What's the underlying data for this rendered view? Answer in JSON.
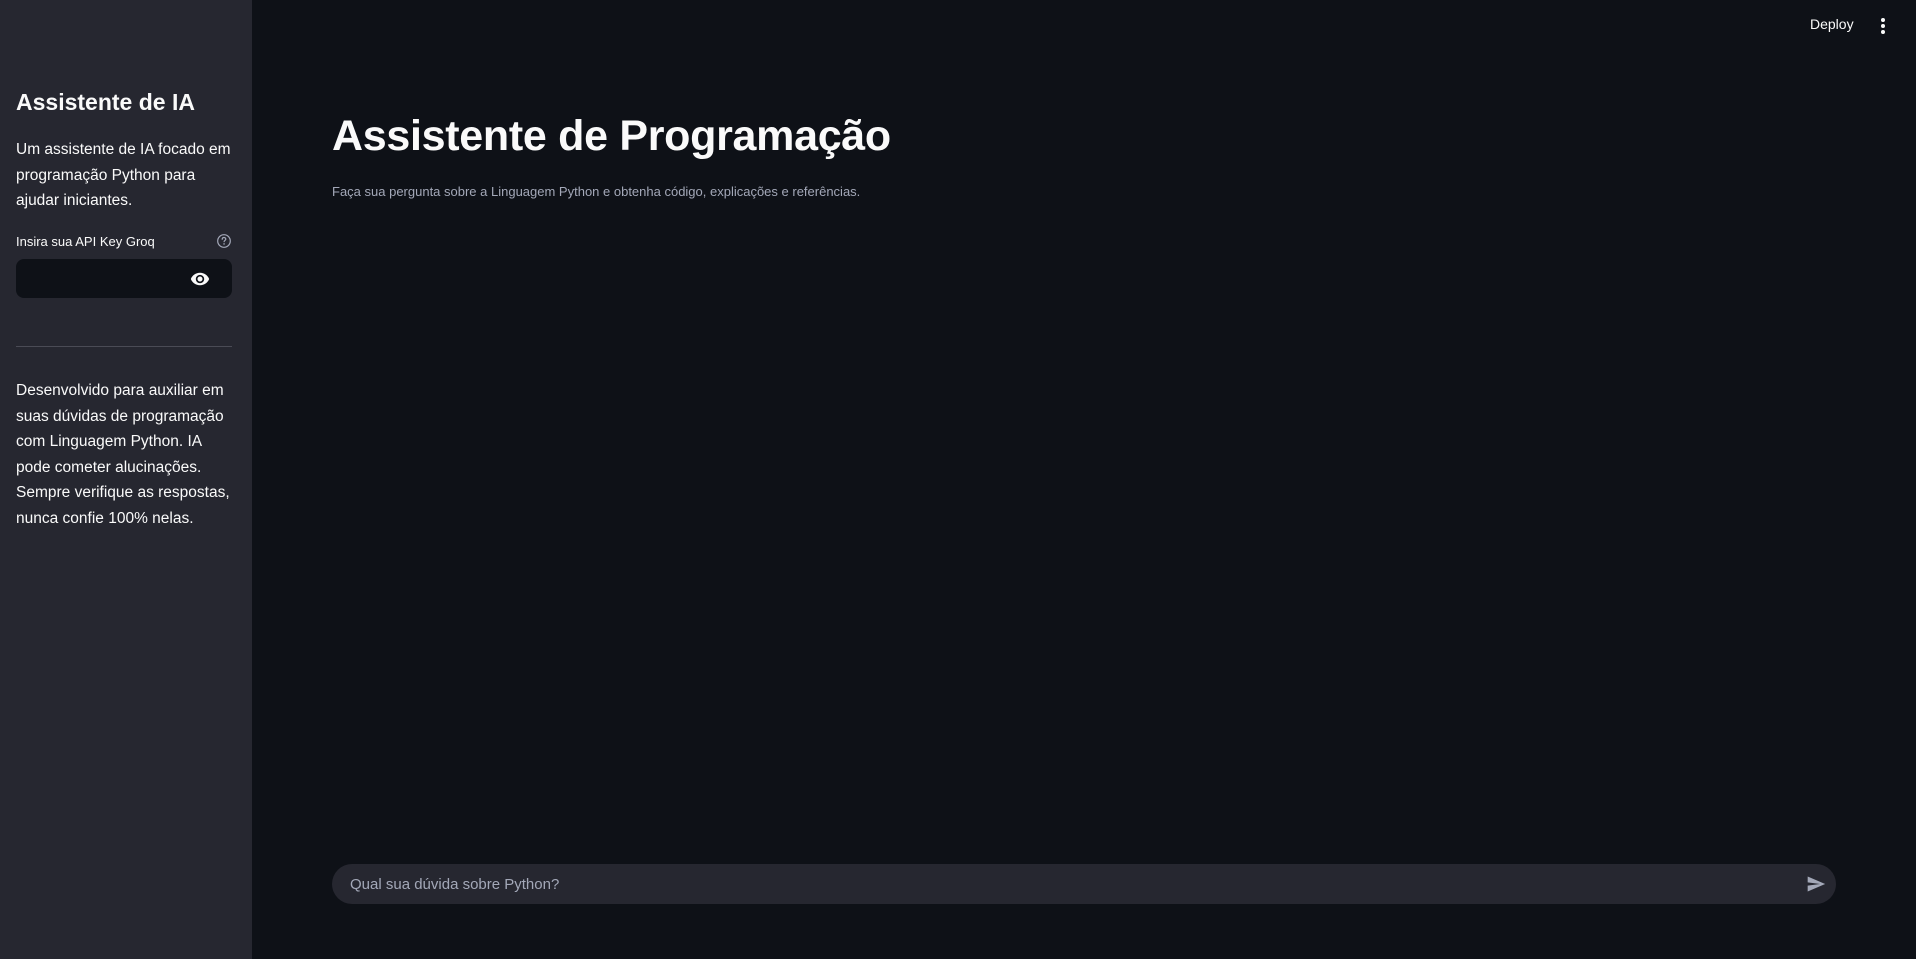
{
  "sidebar": {
    "title": "Assistente de IA",
    "description": "Um assistente de IA focado em programação Python para ajudar iniciantes.",
    "api_key_label": "Insira sua API Key Groq",
    "api_key_value": "",
    "note": "Desenvolvido para auxiliar em suas dúvidas de programação com Linguagem Python. IA pode cometer alucinações. Sempre verifique as respostas, nunca confie 100% nelas."
  },
  "topbar": {
    "deploy_label": "Deploy"
  },
  "main": {
    "title": "Assistente de Programação",
    "subtitle": "Faça sua pergunta sobre a Linguagem Python e obtenha código, explicações e referências."
  },
  "chat": {
    "placeholder": "Qual sua dúvida sobre Python?",
    "value": ""
  },
  "icons": {
    "help": "help-circle-icon",
    "eye": "eye-icon",
    "menu": "vertical-dots-menu-icon",
    "send": "send-icon"
  },
  "colors": {
    "background": "#0e1117",
    "sidebar": "#262730",
    "text": "#fafafa",
    "muted_text": "#a3a8b8"
  }
}
